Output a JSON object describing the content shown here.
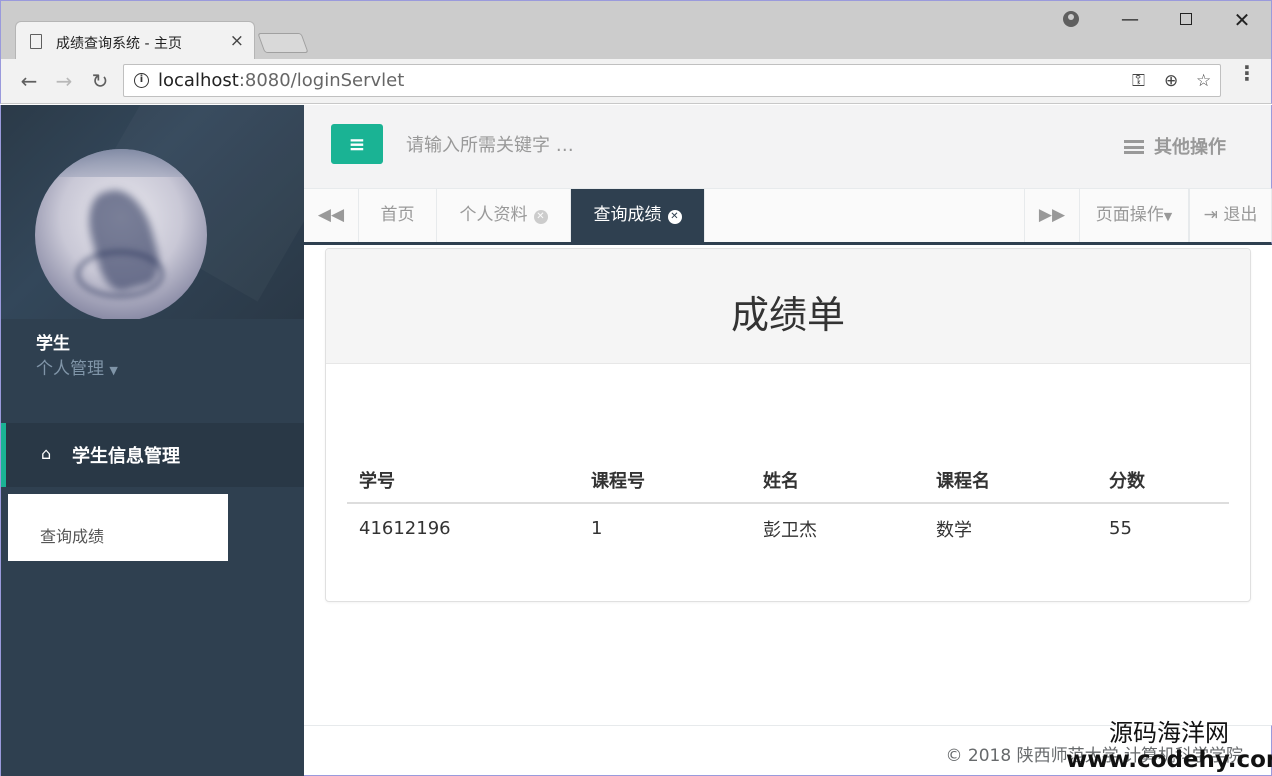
{
  "browser": {
    "tab_title": "成绩查询系统 - 主页",
    "tab_close": "×",
    "url_host": "localhost",
    "url_rest": ":8080/loginServlet",
    "back": "←",
    "forward": "→",
    "reload": "↻",
    "key": "⚿",
    "zoom": "⊕",
    "star": "☆",
    "menu": "⋮",
    "minimize": "—",
    "close": "✕"
  },
  "sidebar": {
    "user_name": "学生",
    "user_menu": "个人管理",
    "caret": "▼",
    "home_icon": "⌂",
    "section_label": "学生信息管理",
    "submenu_item": "查询成绩"
  },
  "topbar": {
    "menu_icon": "≡",
    "search_placeholder": "请输入所需关键字 …",
    "other_ops": "其他操作"
  },
  "tabs": {
    "prev": "◀◀",
    "home": "首页",
    "profile": "个人资料",
    "grades": "查询成绩",
    "close_mark": "✕",
    "next": "▶▶",
    "page_ops": "页面操作",
    "caret": "▼",
    "logout_icon": "⇥",
    "logout": "退出"
  },
  "panel": {
    "title": "成绩单",
    "columns": [
      "学号",
      "课程号",
      "姓名",
      "课程名",
      "分数"
    ],
    "rows": [
      [
        "41612196",
        "1",
        "彭卫杰",
        "数学",
        "55"
      ]
    ]
  },
  "footer": {
    "copyright": "© 2018 陕西师范大学 计算机科学学院"
  },
  "watermark": {
    "cn": "源码海洋网",
    "en": "www.codehy.com"
  },
  "colors": {
    "sidebar": "#2f4050",
    "accent": "#1ab394"
  }
}
